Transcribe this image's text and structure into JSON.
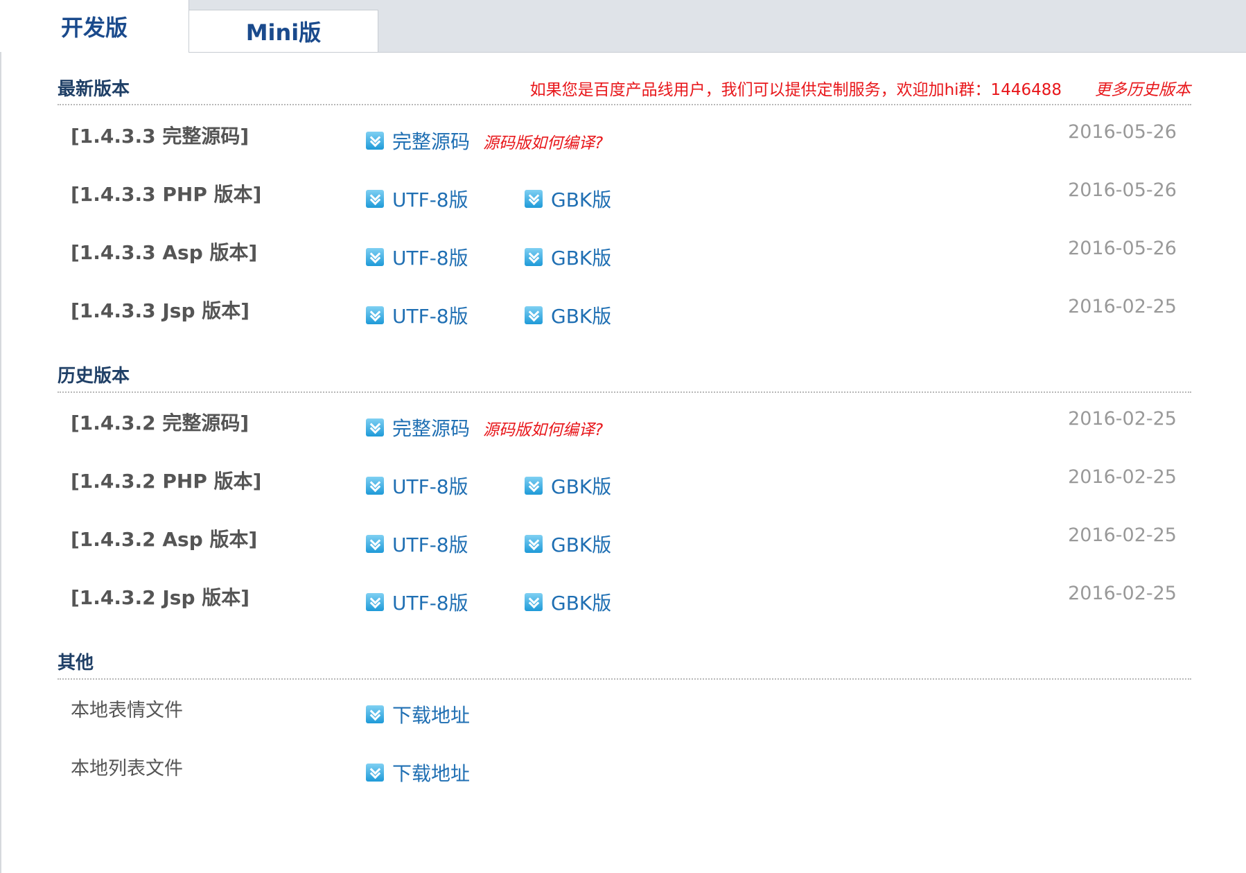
{
  "tabs": [
    {
      "label": "开发版",
      "active": true
    },
    {
      "label": "Mini版",
      "active": false
    }
  ],
  "notice": "如果您是百度产品线用户，我们可以提供定制服务，欢迎加hi群：1446488",
  "more_history": "更多历史版本",
  "sections": [
    {
      "title": "最新版本",
      "rows": [
        {
          "label": "[1.4.3.3 完整源码]",
          "link1": "完整源码",
          "hint": "源码版如何编译?",
          "date": "2016-05-26"
        },
        {
          "label": "[1.4.3.3 PHP 版本]",
          "link1": "UTF-8版",
          "link2": "GBK版",
          "date": "2016-05-26"
        },
        {
          "label": "[1.4.3.3 Asp 版本]",
          "link1": "UTF-8版",
          "link2": "GBK版",
          "date": "2016-05-26"
        },
        {
          "label": "[1.4.3.3 Jsp 版本]",
          "link1": "UTF-8版",
          "link2": "GBK版",
          "date": "2016-02-25"
        }
      ]
    },
    {
      "title": "历史版本",
      "rows": [
        {
          "label": "[1.4.3.2 完整源码]",
          "link1": "完整源码",
          "hint": "源码版如何编译?",
          "date": "2016-02-25"
        },
        {
          "label": "[1.4.3.2 PHP 版本]",
          "link1": "UTF-8版",
          "link2": "GBK版",
          "date": "2016-02-25"
        },
        {
          "label": "[1.4.3.2 Asp 版本]",
          "link1": "UTF-8版",
          "link2": "GBK版",
          "date": "2016-02-25"
        },
        {
          "label": "[1.4.3.2 Jsp 版本]",
          "link1": "UTF-8版",
          "link2": "GBK版",
          "date": "2016-02-25"
        }
      ]
    },
    {
      "title": "其他",
      "rows": [
        {
          "label": "本地表情文件",
          "link1": "下载地址"
        },
        {
          "label": "本地列表文件",
          "link1": "下载地址"
        }
      ]
    }
  ]
}
